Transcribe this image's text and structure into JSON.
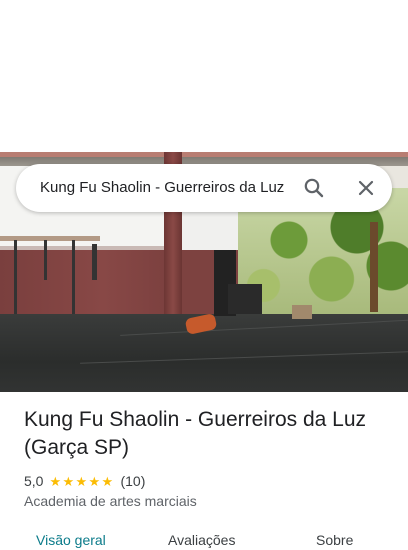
{
  "search": {
    "query": "Kung Fu Shaolin - Guerreiros da Luz",
    "search_icon": "search-icon",
    "close_icon": "close-icon"
  },
  "place": {
    "title": "Kung Fu Shaolin - Guerreiros da Luz (Garça SP)",
    "rating": "5,0",
    "stars": 5,
    "reviews": "(10)",
    "category": "Academia de artes marciais"
  },
  "tabs": [
    {
      "label": "Visão geral",
      "active": true
    },
    {
      "label": "Avaliações",
      "active": false
    },
    {
      "label": "Sobre",
      "active": false
    }
  ],
  "colors": {
    "star": "#fbbc04",
    "active_tab": "#0b7b8a"
  }
}
